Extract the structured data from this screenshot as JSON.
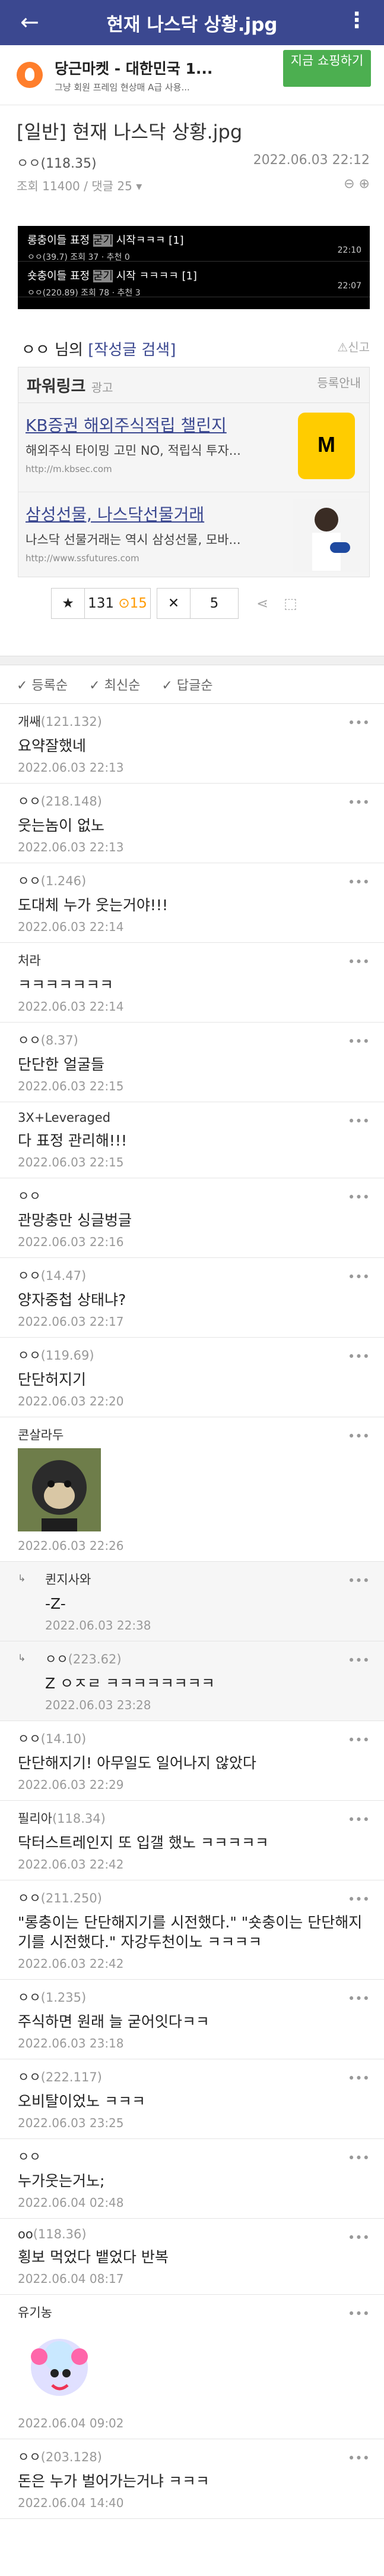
{
  "appbar": {
    "title": "현재 나스닥 상황.jpg",
    "back_icon": "←",
    "more_icon": "⋮"
  },
  "ad": {
    "title": "당근마켓 - 대한민국 1...",
    "desc": "그냥 회원 프레임 현상매 A급 사용...",
    "button": "지금 쇼핑하기"
  },
  "post": {
    "title": "[일반] 현재 나스닥 상황.jpg",
    "author": "ㅇㅇ(118.35)",
    "date": "2022.06.03 22:12",
    "views": "조회 11400 / 댓글 25 ▾",
    "zoom": "⊖ ⊕"
  },
  "image_rows": [
    {
      "title_pre": "롱충이들 표정 ",
      "title_hl": "굳기",
      "title_post": " 시작ㅋㅋㅋ [1]",
      "meta": "ㅇㅇ(39.7) 조회 37 · 추천 0",
      "time": "22:10"
    },
    {
      "title_pre": "숏충이들 표정 ",
      "title_hl": "굳기",
      "title_post": " 시작 ㅋㅋㅋㅋ [1]",
      "meta": "ㅇㅇ(220.89) 조회 78 · 추천 3",
      "time": "22:07"
    }
  ],
  "writer": {
    "prefix": "ㅇㅇ 님의 ",
    "link": "[작성글 검색]",
    "report": "⚠신고"
  },
  "power": {
    "title": "파워링크",
    "tag": "광고",
    "register": "등록안내",
    "links": [
      {
        "title": "KB증권 해외주식적립 챌린지",
        "desc": "해외주식 타이밍 고민 NO, 적립식 투자...",
        "url": "http://m.kbsec.com"
      },
      {
        "title": "삼성선물, 나스닥선물거래",
        "desc": "나스닥 선물거래는 역시 삼성선물, 모바...",
        "url": "http://www.ssfutures.com"
      }
    ]
  },
  "votes": {
    "up": "131",
    "gold": "⊙15",
    "down": "5"
  },
  "sort": [
    "✓ 등록순",
    "✓ 최신순",
    "✓ 답글순"
  ],
  "comments": [
    {
      "nick": "개쌔",
      "ip": "(121.132)",
      "body": "요약잘했네",
      "date": "2022.06.03 22:13"
    },
    {
      "nick": "ㅇㅇ",
      "ip": "(218.148)",
      "body": "웃는놈이 없노",
      "date": "2022.06.03 22:13"
    },
    {
      "nick": "ㅇㅇ",
      "ip": "(1.246)",
      "body": "도대체 누가 웃는거야!!!",
      "date": "2022.06.03 22:14"
    },
    {
      "nick": "처라",
      "ip": "",
      "body": "ㅋㅋㅋㅋㅋㅋㅋ",
      "date": "2022.06.03 22:14"
    },
    {
      "nick": "ㅇㅇ",
      "ip": "(8.37)",
      "body": "단단한 얼굴들",
      "date": "2022.06.03 22:15"
    },
    {
      "nick": "3X+Leveraged",
      "ip": "",
      "body": "다 표정 관리해!!!",
      "date": "2022.06.03 22:15"
    },
    {
      "nick": "ㅇㅇ",
      "ip": "",
      "body": "관망충만 싱글벙글",
      "date": "2022.06.03 22:16"
    },
    {
      "nick": "ㅇㅇ",
      "ip": "(14.47)",
      "body": "양자중첩 상태냐?",
      "date": "2022.06.03 22:17"
    },
    {
      "nick": "ㅇㅇ",
      "ip": "(119.69)",
      "body": "단단허지기",
      "date": "2022.06.03 22:20"
    },
    {
      "nick": "콘살라두",
      "ip": "",
      "body": "",
      "date": "2022.06.03 22:26"
    },
    {
      "nick": "퀸지사와",
      "ip": "",
      "body": "-Z-",
      "date": "2022.06.03 22:38",
      "reply": true
    },
    {
      "nick": "ㅇㅇ",
      "ip": "(223.62)",
      "body": "Z ㅇㅈㄹ ㅋㅋㅋㅋㅋㅋㅋㅋ",
      "date": "2022.06.03 23:28",
      "reply": true
    },
    {
      "nick": "ㅇㅇ",
      "ip": "(14.10)",
      "body": "단단해지기! 아무일도 일어나지 않았다",
      "date": "2022.06.03 22:29"
    },
    {
      "nick": "필리아",
      "ip": "(118.34)",
      "body": "닥터스트레인지 또 입갤 했노 ㅋㅋㅋㅋㅋ",
      "date": "2022.06.03 22:42"
    },
    {
      "nick": "ㅇㅇ",
      "ip": "(211.250)",
      "body": "\"롱충이는 단단해지기를 시전했다.\" \"숏충이는 단단해지기를 시전했다.\" 자강두천이노 ㅋㅋㅋㅋ",
      "date": "2022.06.03 22:42"
    },
    {
      "nick": "ㅇㅇ",
      "ip": "(1.235)",
      "body": "주식하면 원래 늘 굳어잇다ㅋㅋ",
      "date": "2022.06.03 23:18"
    },
    {
      "nick": "ㅇㅇ",
      "ip": "(222.117)",
      "body": "오비탈이었노 ㅋㅋㅋ",
      "date": "2022.06.03 23:25"
    },
    {
      "nick": "ㅇㅇ",
      "ip": "",
      "body": "누가웃는거노;",
      "date": "2022.06.04 02:48"
    },
    {
      "nick": "oo",
      "ip": "(118.36)",
      "body": "횡보 먹었다 뱉었다 반복",
      "date": "2022.06.04 08:17"
    },
    {
      "nick": "유기농",
      "ip": "",
      "body": "",
      "date": "2022.06.04 09:02"
    },
    {
      "nick": "ㅇㅇ",
      "ip": "(203.128)",
      "body": "돈은 누가 벌어가는거냐 ㅋㅋㅋ",
      "date": "2022.06.04 14:40"
    }
  ]
}
